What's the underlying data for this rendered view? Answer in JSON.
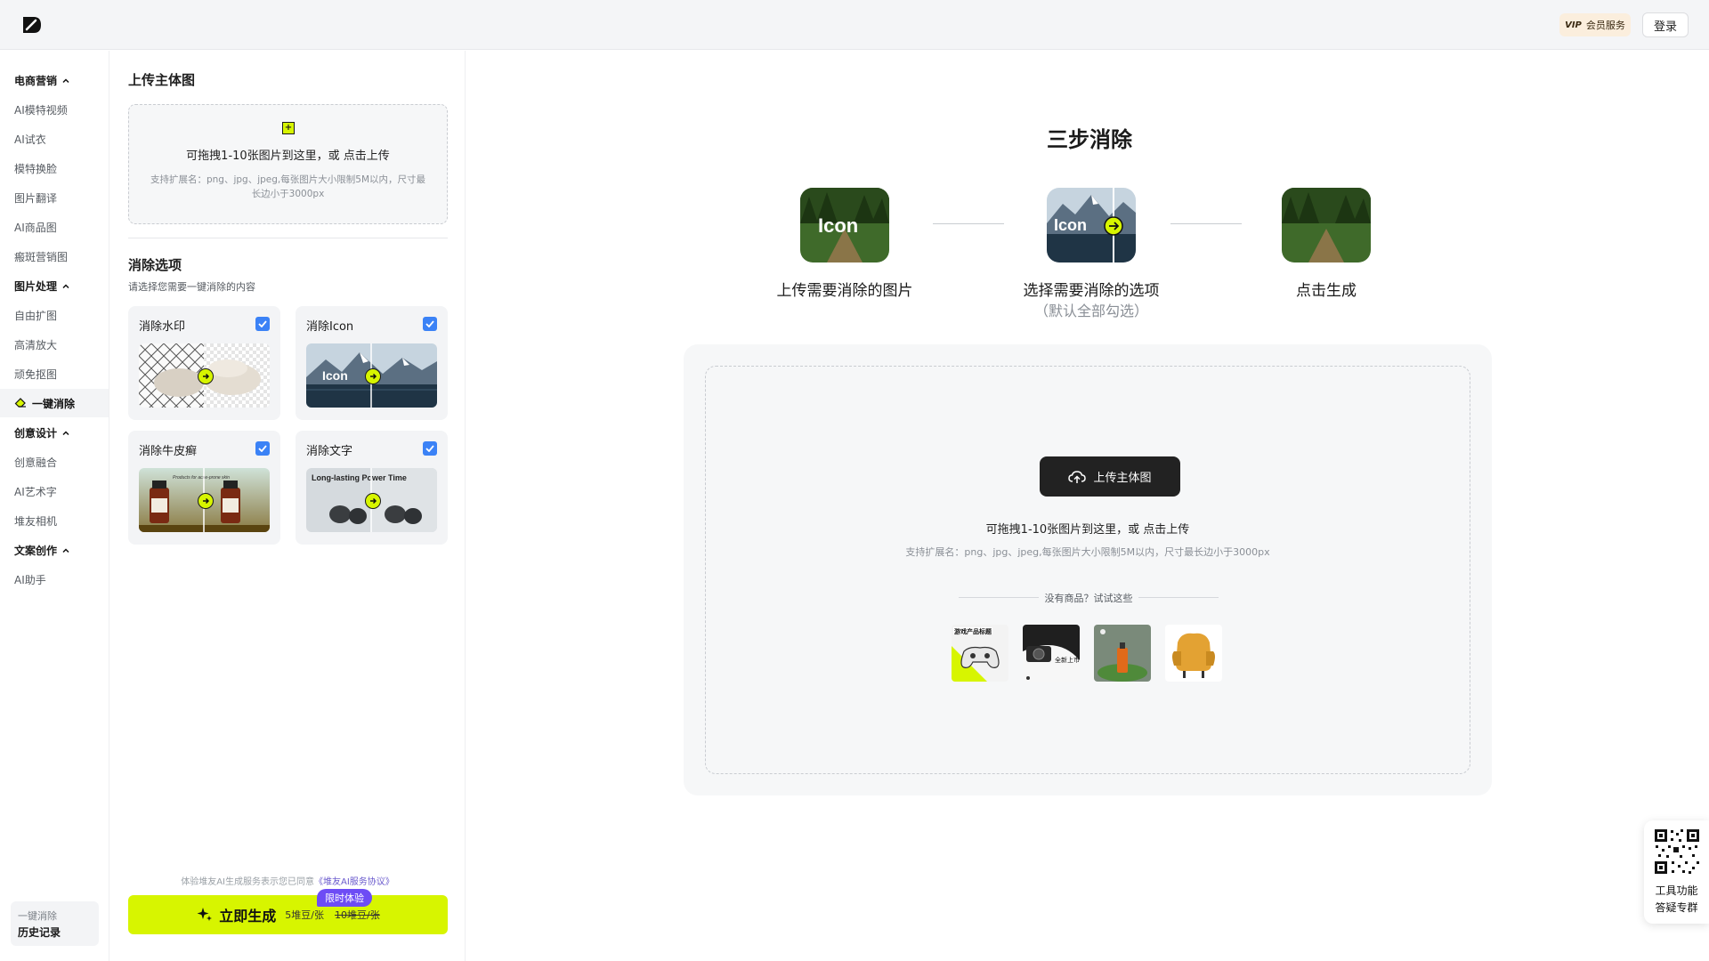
{
  "header": {
    "vip_tag": "VIP",
    "vip_label": "会员服务",
    "login_label": "登录"
  },
  "sidebar": {
    "groups": [
      {
        "title": "电商营销",
        "items": [
          "AI模特视频",
          "AI试衣",
          "模特换脸",
          "图片翻译",
          "AI商品图",
          "瘢斑营销图"
        ]
      },
      {
        "title": "图片处理",
        "items": [
          "自由扩图",
          "高清放大",
          "顽免抠图",
          "一键消除"
        ]
      },
      {
        "title": "创意设计",
        "items": [
          "创意融合",
          "AI艺术字",
          "堆友相机"
        ]
      },
      {
        "title": "文案创作",
        "items": [
          "AI助手"
        ]
      }
    ],
    "history_line1": "一键消除",
    "history_line2": "历史记录"
  },
  "panel": {
    "title": "上传主体图",
    "drop_main": "可拖拽1-10张图片到这里，或 点击上传",
    "drop_hint": "支持扩展名：png、jpg、jpeg,每张图片大小限制5M以内，尺寸最长边小于3000px",
    "options_title": "消除选项",
    "options_sub": "请选择您需要一键消除的内容",
    "options": [
      {
        "label": "消除水印"
      },
      {
        "label": "消除Icon",
        "thumb_text": "Icon"
      },
      {
        "label": "消除牛皮癣",
        "thumb_text": "Products for acne-prone skin"
      },
      {
        "label": "消除文字",
        "thumb_text": "Long-lasting Power Time"
      }
    ],
    "agreement_prefix": "体验堆友AI生成服务表示您已同意",
    "agreement_link": "《堆友AI服务协议》",
    "generate_label": "立即生成",
    "price_new": "5堆豆/张",
    "price_old": "10堆豆/张",
    "promo": "限时体验"
  },
  "main": {
    "title": "三步消除",
    "steps": [
      {
        "label": "上传需要消除的图片",
        "thumb_text": "Icon"
      },
      {
        "label": "选择需要消除的选项",
        "sub": "（默认全部勾选）",
        "thumb_text": "Icon"
      },
      {
        "label": "点击生成"
      }
    ],
    "upload_button": "上传主体图",
    "upload_main": "可拖拽1-10张图片到这里，或 点击上传",
    "upload_hint": "支持扩展名：png、jpg、jpeg,每张图片大小限制5M以内，尺寸最长边小于3000px",
    "try_text": "没有商品？试试这些",
    "samples": [
      {
        "label": "游戏产品标题"
      },
      {
        "label": "全新上市"
      },
      {
        "label": ""
      },
      {
        "label": ""
      }
    ]
  },
  "qr": {
    "line1": "工具功能",
    "line2": "答疑专群"
  },
  "colors": {
    "accent": "#d7f500",
    "check": "#3b82f6",
    "promo": "#6d4cf5"
  }
}
